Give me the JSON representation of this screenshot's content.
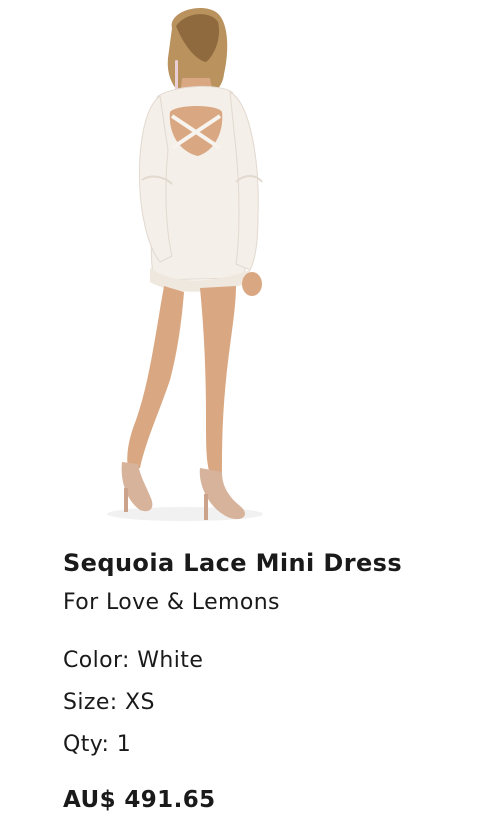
{
  "product": {
    "image_alt": "Model wearing white lace mini dress, back view",
    "name": "Sequoia Lace Mini Dress",
    "brand": "For Love & Lemons",
    "attributes": {
      "color_label": "Color:",
      "color_value": "White",
      "size_label": "Size:",
      "size_value": "XS",
      "qty_label": "Qty:",
      "qty_value": "1"
    },
    "price": "AU$ 491.65"
  },
  "colors": {
    "text": "#1a1a1a",
    "background": "#ffffff",
    "dress": "#f4efe9",
    "skin": "#d9a882",
    "hair": "#b9925e",
    "heels": "#d6b39a"
  }
}
